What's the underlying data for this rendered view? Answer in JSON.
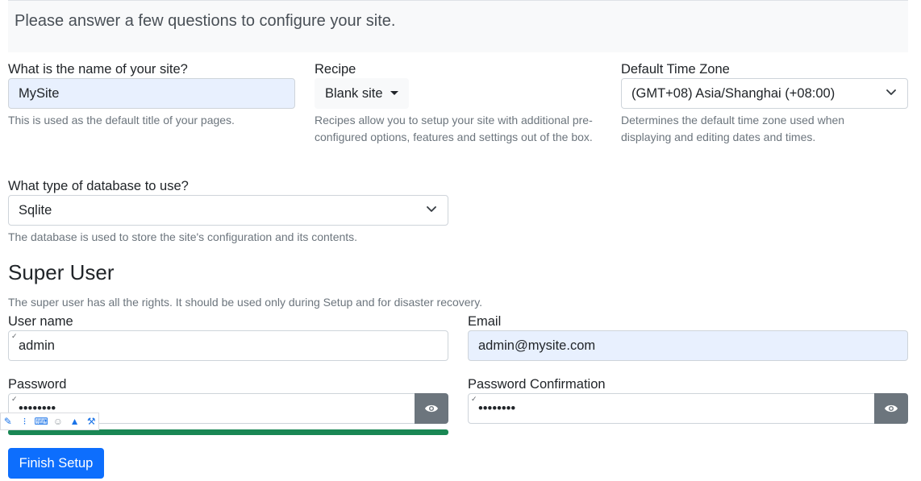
{
  "intro": {
    "text": "Please answer a few questions to configure your site."
  },
  "site_name": {
    "label": "What is the name of your site?",
    "value": "MySite",
    "help": "This is used as the default title of your pages."
  },
  "recipe": {
    "label": "Recipe",
    "selected": "Blank site",
    "help": "Recipes allow you to setup your site with additional pre-configured options, features and settings out of the box."
  },
  "timezone": {
    "label": "Default Time Zone",
    "selected": "(GMT+08) Asia/Shanghai (+08:00)",
    "help": "Determines the default time zone used when displaying and editing dates and times."
  },
  "database": {
    "label": "What type of database to use?",
    "selected": "Sqlite",
    "help": "The database is used to store the site's configuration and its contents."
  },
  "super_user": {
    "title": "Super User",
    "help": "The super user has all the rights. It should be used only during Setup and for disaster recovery.",
    "username_label": "User name",
    "username_value": "admin",
    "email_label": "Email",
    "email_value": "admin@mysite.com",
    "password_label": "Password",
    "password_value": "••••••••",
    "password_confirm_label": "Password Confirmation",
    "password_confirm_value": "••••••••",
    "password_strength": 1.0
  },
  "finish_button": "Finish Setup",
  "colors": {
    "primary": "#0d6efd",
    "success": "#198754",
    "secondary": "#6c757d",
    "autofill": "#e8f0fe"
  },
  "icons": [
    "chevron-down-icon",
    "caret-down-icon",
    "eye-icon",
    "keyboard-icon",
    "shirt-icon",
    "wrench-icon"
  ]
}
